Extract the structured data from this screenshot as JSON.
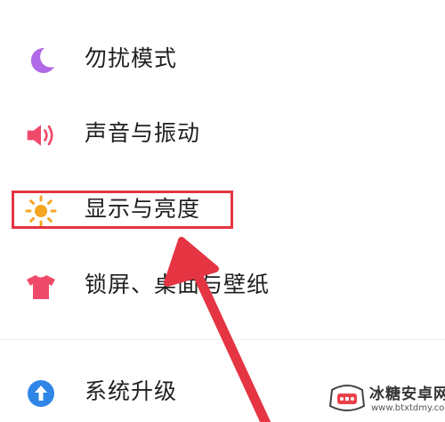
{
  "settings": {
    "items": [
      {
        "label": "勿扰模式",
        "icon": "moon-icon"
      },
      {
        "label": "声音与振动",
        "icon": "speaker-icon"
      },
      {
        "label": "显示与亮度",
        "icon": "sun-icon"
      },
      {
        "label": "锁屏、桌面与壁纸",
        "icon": "tshirt-icon"
      },
      {
        "label": "系统升级",
        "icon": "upgrade-arrow-icon"
      }
    ]
  },
  "watermark": {
    "title": "冰糖安卓网",
    "url": "www.btxtdmy.com"
  },
  "colors": {
    "moon": "#b06ae8",
    "speaker": "#f04a6a",
    "sun": "#f5a623",
    "tshirt": "#f04a6a",
    "upgrade": "#2f86e6",
    "annotation": "#e53442"
  }
}
